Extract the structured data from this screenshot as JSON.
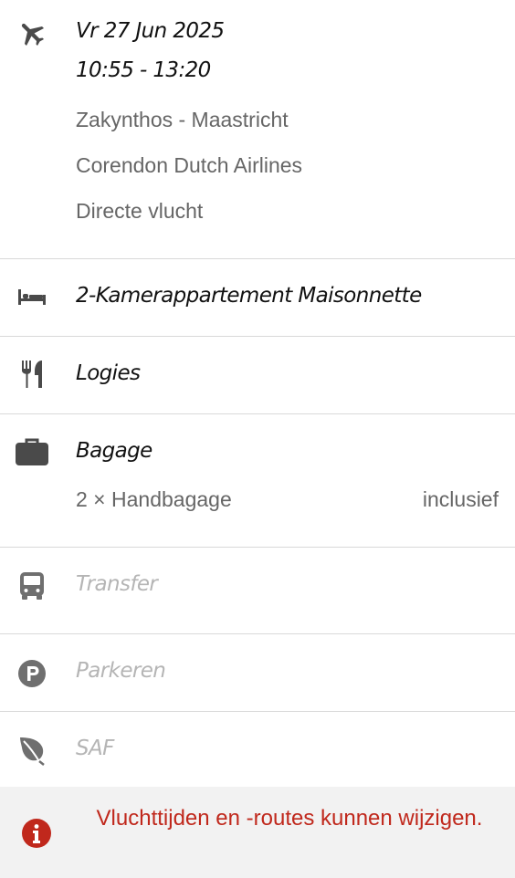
{
  "flight": {
    "date": "Vr 27 Jun 2025",
    "time": "10:55 - 13:20",
    "route": "Zakynthos - Maastricht",
    "airline": "Corendon Dutch Airlines",
    "type": "Directe vlucht",
    "icon": "airplane-icon"
  },
  "room": {
    "title": "2-Kamerappartement Maisonnette",
    "icon": "bed-icon"
  },
  "board": {
    "title": "Logies",
    "icon": "cutlery-icon"
  },
  "baggage": {
    "title": "Bagage",
    "icon": "suitcase-icon",
    "item": "2 × Handbagage",
    "status": "inclusief"
  },
  "transfer": {
    "title": "Transfer",
    "icon": "bus-icon"
  },
  "parking": {
    "title": "Parkeren",
    "icon": "parking-icon"
  },
  "saf": {
    "title": "SAF",
    "icon": "leaf-icon"
  },
  "notice": {
    "text": "Vluchttijden en -routes kunnen wijzigen.",
    "icon": "info-icon",
    "color": "#c0281c",
    "background": "#f2f2f2"
  },
  "colors": {
    "icon_dark": "#4a4a4a",
    "icon_muted": "#6f6f6f",
    "divider": "#d9d9d9"
  }
}
